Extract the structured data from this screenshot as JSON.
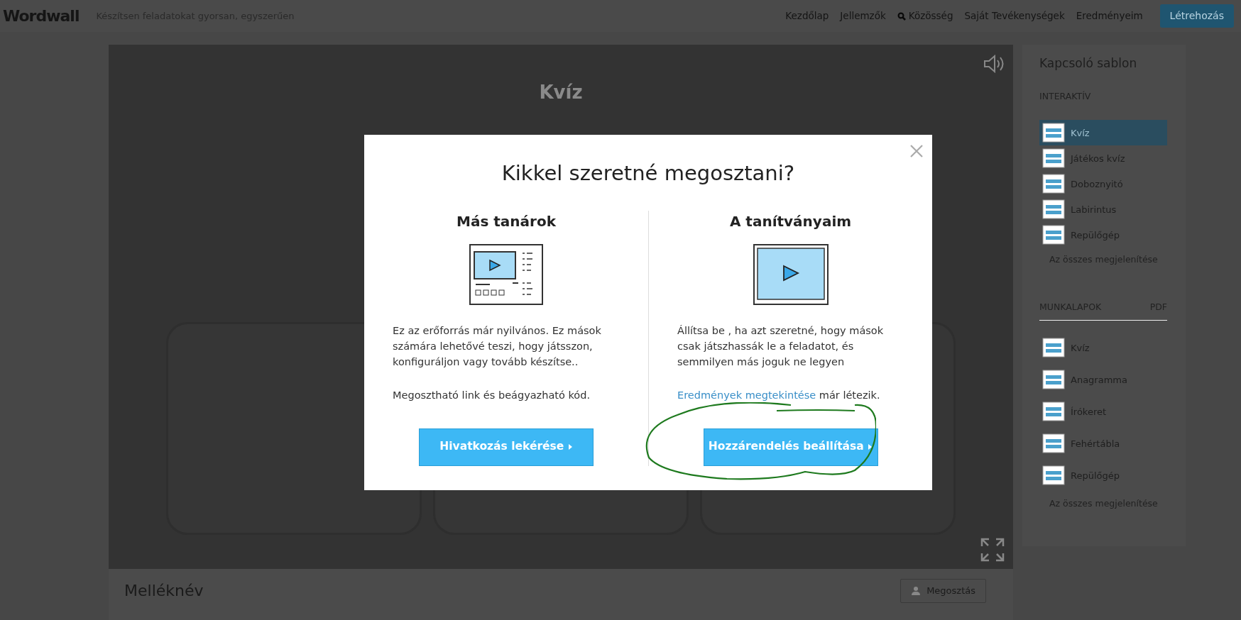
{
  "navbar": {
    "logo": "Wordwall",
    "tagline": "Készítsen feladatokat gyorsan, egyszerűen",
    "links": [
      {
        "label": "Kezdőlap",
        "kind": "plain"
      },
      {
        "label": "Jellemzők",
        "kind": "plain"
      },
      {
        "label": "Közösség",
        "kind": "search"
      },
      {
        "label": "Saját Tevékenységek",
        "kind": "plain"
      },
      {
        "label": "Eredményeim",
        "kind": "plain"
      }
    ],
    "create_button": "Létrehozás"
  },
  "game": {
    "title": "Kvíz"
  },
  "activity": {
    "title": "Melléknév",
    "share_button": "Megosztás"
  },
  "sidebar": {
    "title": "Kapcsoló sablon",
    "sections": [
      {
        "heading": "INTERAKTÍV",
        "items": [
          {
            "label": "Kvíz",
            "selected": true
          },
          {
            "label": "Játékos kvíz",
            "selected": false
          },
          {
            "label": "Doboznyitó",
            "selected": false
          },
          {
            "label": "Labirintus",
            "selected": false
          },
          {
            "label": "Repülőgép",
            "selected": false
          }
        ],
        "show_all": "Az összes megjelenítése"
      },
      {
        "heading": "MUNKALAPOK",
        "tag": "PDF",
        "items": [
          {
            "label": "Kvíz",
            "selected": false
          },
          {
            "label": "Anagramma",
            "selected": false
          },
          {
            "label": "Írókeret",
            "selected": false
          },
          {
            "label": "Fehértábla",
            "selected": false
          },
          {
            "label": "Repülőgép",
            "selected": false
          }
        ],
        "show_all": "Az összes megjelenítése"
      }
    ]
  },
  "modal": {
    "title": "Kikkel szeretné megosztani?",
    "columns": [
      {
        "heading": "Más tanárok",
        "kind": "teachers",
        "paragraphs": [
          {
            "text": "Ez az erőforrás már nyilvános. Ez mások számára lehetővé teszi, hogy játsszon, konfiguráljon vagy tovább készítse.."
          },
          {
            "text": "Megosztható link és beágyazható kód."
          }
        ],
        "button": "Hivatkozás lekérése",
        "highlighted": false
      },
      {
        "heading": "A tanítványaim",
        "kind": "students",
        "paragraphs": [
          {
            "text": "Állítsa be , ha azt szeretné, hogy mások csak játszhassák le a feladatot, és semmilyen más joguk ne legyen"
          },
          {
            "link": "Eredmények megtekintése",
            "text": "már létezik."
          }
        ],
        "button": "Hozzárendelés beállítása",
        "highlighted": true
      }
    ]
  }
}
